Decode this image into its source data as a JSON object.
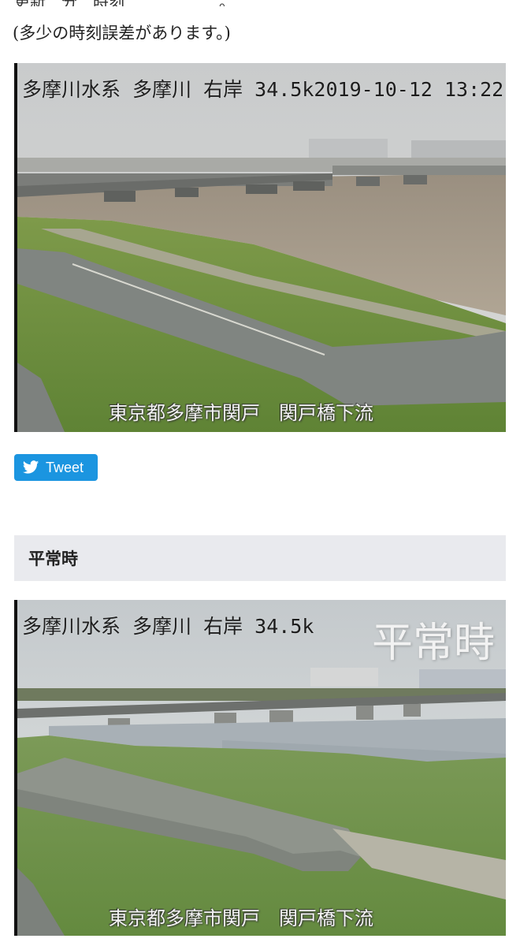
{
  "page": {
    "top_cut_text": "更新　分　時刻　　　　　　。",
    "notice": "(多少の時刻誤差があります。)"
  },
  "camera_flood": {
    "overlay_top": "多摩川水系 多摩川 右岸 34.5k2019-10-12 13:22",
    "overlay_bottom": "東京都多摩市関戸　関戸橋下流"
  },
  "tweet": {
    "label": "Tweet",
    "icon": "twitter-bird-icon",
    "color": "#1b95e0"
  },
  "section_normal": {
    "title": "平常時"
  },
  "camera_normal": {
    "overlay_top": "多摩川水系 多摩川 右岸 34.5k",
    "overlay_big": "平常時",
    "overlay_bottom": "東京都多摩市関戸　関戸橋下流"
  }
}
